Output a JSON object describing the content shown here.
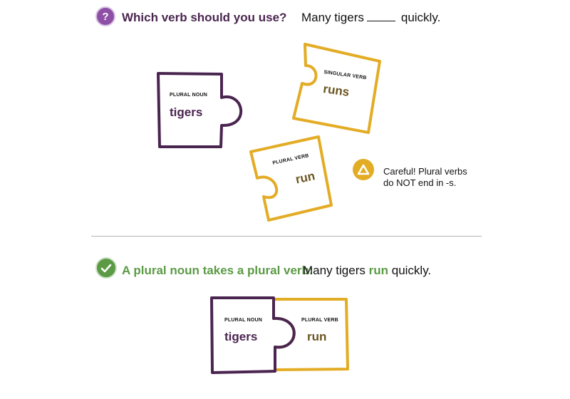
{
  "question": {
    "icon": "question-mark-icon",
    "icon_glyph": "?",
    "prompt": "Which verb should you use?",
    "sentence_before": "Many tigers",
    "sentence_after": "quickly."
  },
  "pieces_top": [
    {
      "label": "PLURAL NOUN",
      "word": "tigers",
      "color": "#4a2550"
    },
    {
      "label": "SINGULAR VERB",
      "word": "runs",
      "color": "#e3ac25"
    },
    {
      "label": "PLURAL VERB",
      "word": "run",
      "color": "#e3ac25"
    }
  ],
  "warning": {
    "icon": "warning-triangle-icon",
    "line1": "Careful!  Plural verbs",
    "line2": "do NOT end in -s."
  },
  "answer": {
    "icon": "check-icon",
    "rule": "A plural noun takes a plural verb:",
    "sentence_before": "Many tigers",
    "verb": "run",
    "sentence_after": "quickly."
  },
  "pieces_bottom": [
    {
      "label": "PLURAL NOUN",
      "word": "tigers",
      "color": "#4a2550"
    },
    {
      "label": "PLURAL VERB",
      "word": "run",
      "color": "#e3ac25"
    }
  ],
  "colors": {
    "purple": "#4a2550",
    "gold": "#e3ac25",
    "green": "#5c9a46",
    "question_purple": "#8e4fa6"
  }
}
